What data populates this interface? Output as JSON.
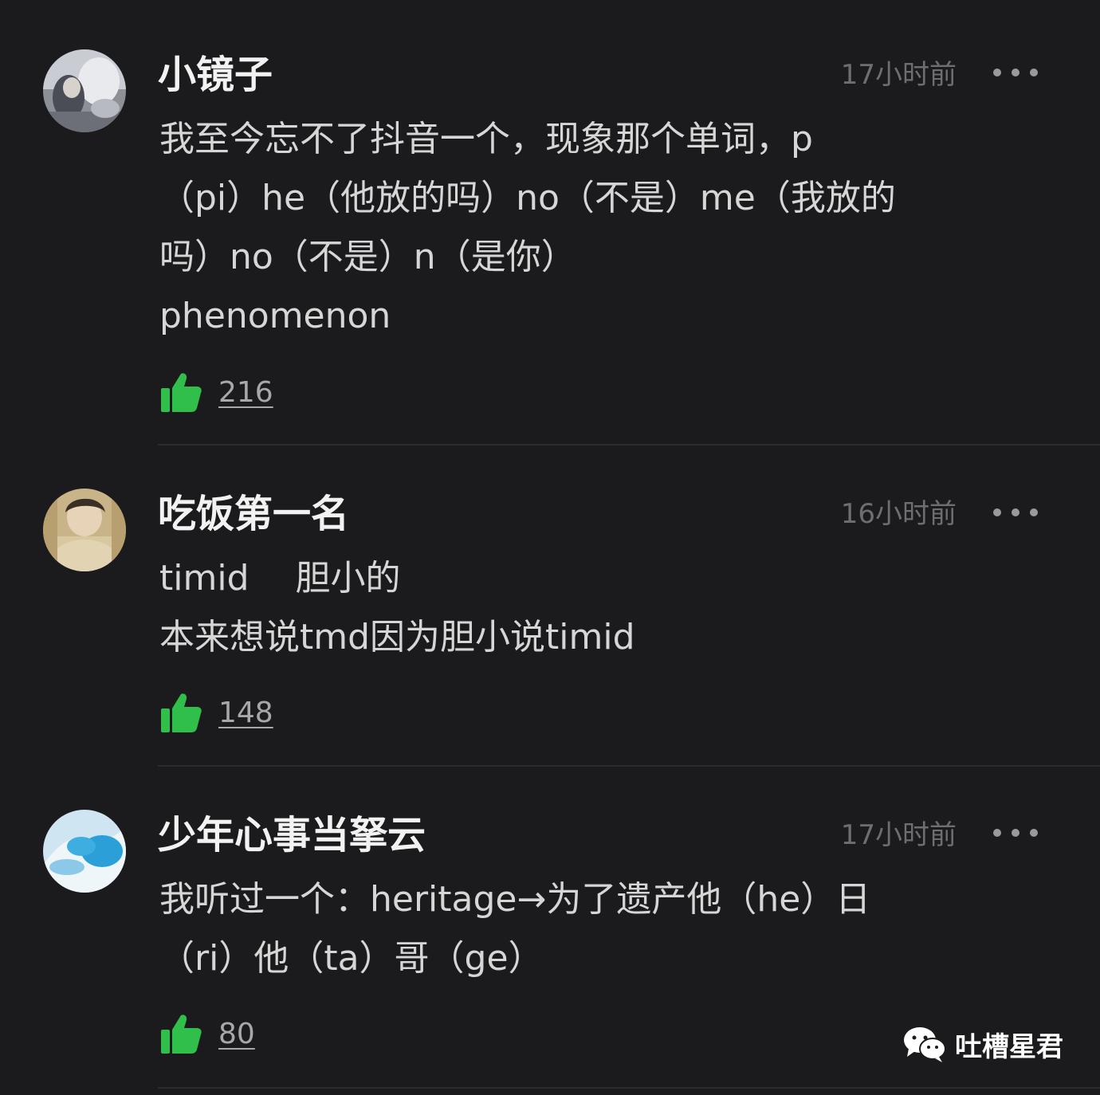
{
  "comments": [
    {
      "username": "小镜子",
      "time": "17小时前",
      "lines": [
        "我至今忘不了抖音一个，现象那个单词，p",
        "（pi）he（他放的吗）no（不是）me（我放的",
        "吗）no（不是）n（是你）",
        "phenomenon"
      ],
      "likes": "216"
    },
    {
      "username": "吃饭第一名",
      "time": "16小时前",
      "lines": [
        "timid　 胆小的",
        "本来想说tmd因为胆小说timid"
      ],
      "likes": "148"
    },
    {
      "username": "少年心事当拏云",
      "time": "17小时前",
      "lines": [
        "我听过一个：heritage→为了遗产他（he）日",
        "（ri）他（ta）哥（ge）"
      ],
      "likes": "80"
    }
  ],
  "watermark": {
    "text": "吐槽星君",
    "icon": "wechat-icon"
  },
  "colors": {
    "background": "#1b1b1d",
    "like_green": "#2fbf4a",
    "username": "#f2f2f2",
    "body": "#d6d6d6",
    "time": "#6e6e70"
  }
}
